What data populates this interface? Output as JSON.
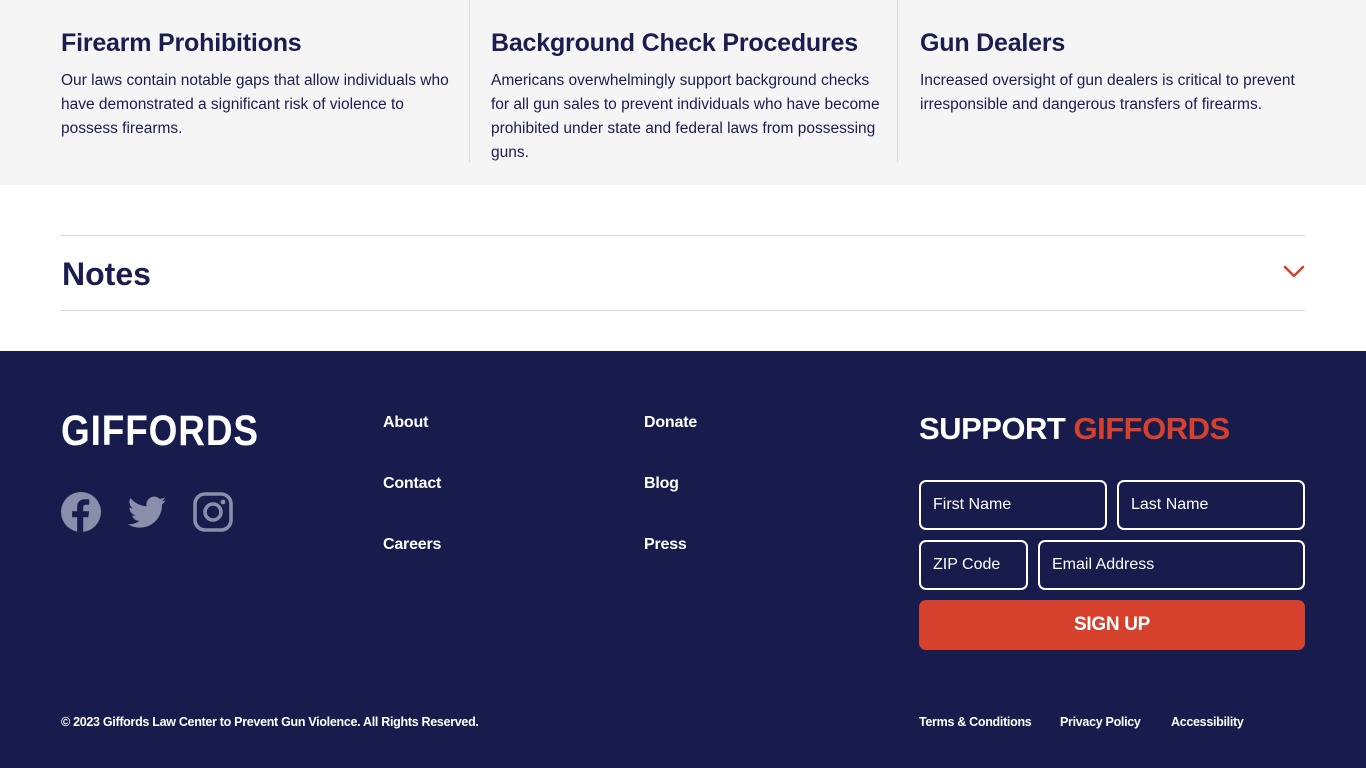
{
  "cards": [
    {
      "title": "Firearm Prohibitions",
      "description": "Our laws contain notable gaps that allow individuals who have demonstrated a significant risk of violence to possess firearms."
    },
    {
      "title": "Background Check Procedures",
      "description": "Americans overwhelmingly support background checks for all gun sales to prevent individuals who have become prohibited under state and federal laws from possessing guns."
    },
    {
      "title": "Gun Dealers",
      "description": "Increased oversight of gun dealers is critical to prevent irresponsible and dangerous transfers of firearms."
    }
  ],
  "notes": {
    "title": "Notes",
    "icon": "chevron-down-icon",
    "accent_color": "#d6412e"
  },
  "footer": {
    "logo": "GIFFORDS",
    "social": [
      "facebook-icon",
      "twitter-icon",
      "instagram-icon"
    ],
    "links_col1": [
      "About",
      "Contact",
      "Careers"
    ],
    "links_col2": [
      "Donate",
      "Blog",
      "Press"
    ],
    "support_title_white": "SUPPORT",
    "support_title_red": "GIFFORDS",
    "form": {
      "first_name_placeholder": "First Name",
      "last_name_placeholder": "Last Name",
      "zip_placeholder": "ZIP Code",
      "email_placeholder": "Email Address",
      "submit_label": "SIGN UP"
    },
    "copyright": "© 2023 Giffords Law Center to Prevent Gun Violence. All Rights Reserved.",
    "legal_links": [
      "Terms & Conditions",
      "Privacy Policy",
      "Accessibility"
    ],
    "background_color": "#181c4c",
    "accent_color": "#d6412e"
  }
}
